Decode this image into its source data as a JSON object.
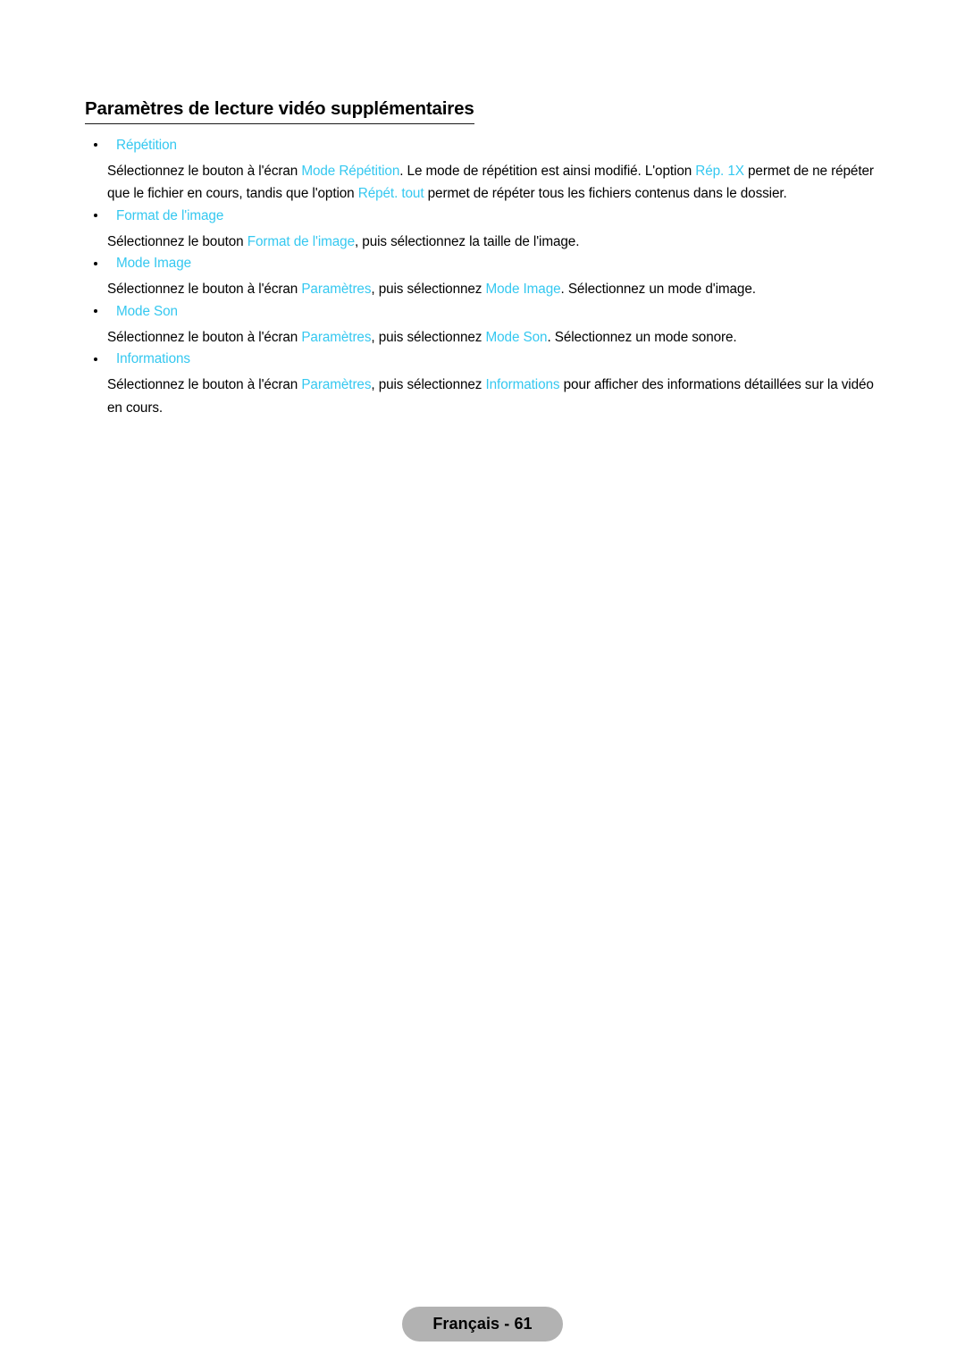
{
  "document": {
    "title": "Paramètres de lecture vidéo supplémentaires",
    "accent_color": "#35c8f0",
    "text_color": "#000000",
    "background_color": "#ffffff"
  },
  "sections": [
    {
      "bullet_label": "Répétition",
      "paragraph": {
        "runs": [
          {
            "text": "Sélectionnez le bouton à l'écran ",
            "highlight": false
          },
          {
            "text": "Mode Répétition",
            "highlight": true
          },
          {
            "text": ". Le mode de répétition est ainsi modifié. L'option ",
            "highlight": false
          },
          {
            "text": "Rép. 1X",
            "highlight": true
          },
          {
            "text": " permet de ne répéter que le fichier en cours, tandis que l'option ",
            "highlight": false
          },
          {
            "text": "Répét. tout",
            "highlight": true
          },
          {
            "text": " permet de répéter tous les fichiers contenus dans le dossier.",
            "highlight": false
          }
        ]
      }
    },
    {
      "bullet_label": "Format de l'image",
      "paragraph": {
        "runs": [
          {
            "text": "Sélectionnez le bouton ",
            "highlight": false
          },
          {
            "text": "Format de l'image",
            "highlight": true
          },
          {
            "text": ", puis sélectionnez la taille de l'image.",
            "highlight": false
          }
        ]
      }
    },
    {
      "bullet_label": "Mode Image",
      "paragraph": {
        "runs": [
          {
            "text": "Sélectionnez le bouton à l'écran ",
            "highlight": false
          },
          {
            "text": "Paramètres",
            "highlight": true
          },
          {
            "text": ", puis sélectionnez ",
            "highlight": false
          },
          {
            "text": "Mode Image",
            "highlight": true
          },
          {
            "text": ". Sélectionnez un mode d'image.",
            "highlight": false
          }
        ]
      }
    },
    {
      "bullet_label": "Mode Son",
      "paragraph": {
        "runs": [
          {
            "text": "Sélectionnez le bouton à l'écran ",
            "highlight": false
          },
          {
            "text": "Paramètres",
            "highlight": true
          },
          {
            "text": ", puis sélectionnez ",
            "highlight": false
          },
          {
            "text": "Mode Son",
            "highlight": true
          },
          {
            "text": ". Sélectionnez un mode sonore.",
            "highlight": false
          }
        ]
      }
    },
    {
      "bullet_label": "Informations",
      "paragraph": {
        "runs": [
          {
            "text": "Sélectionnez le bouton à l'écran ",
            "highlight": false
          },
          {
            "text": "Paramètres",
            "highlight": true
          },
          {
            "text": ", puis sélectionnez ",
            "highlight": false
          },
          {
            "text": "Informations",
            "highlight": true
          },
          {
            "text": " pour afficher des informations détaillées sur la vidéo en cours.",
            "highlight": false
          }
        ]
      }
    }
  ],
  "footer": {
    "label": "Français - 61"
  }
}
